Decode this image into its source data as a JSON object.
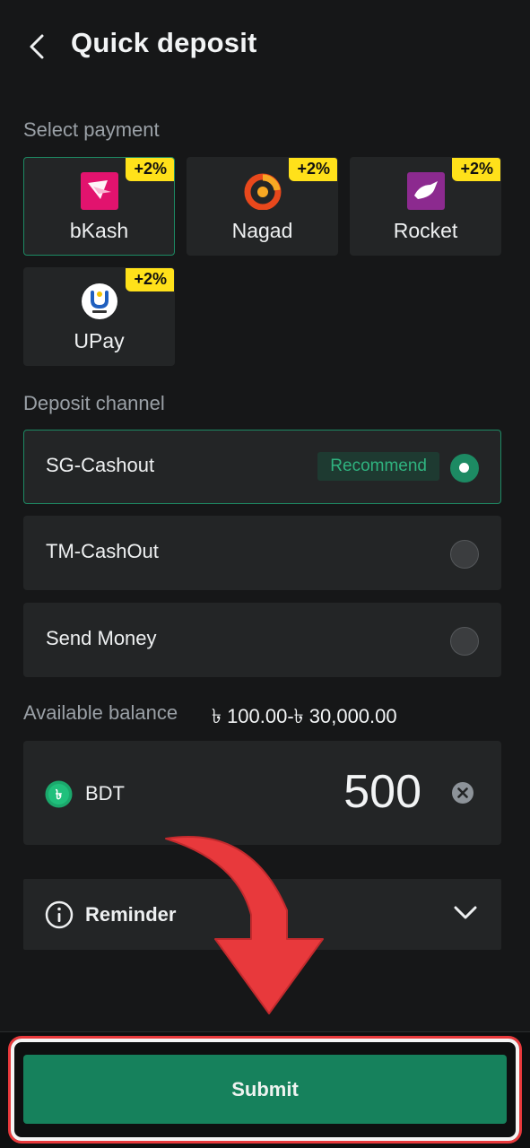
{
  "header": {
    "title": "Quick deposit"
  },
  "payment": {
    "label": "Select payment",
    "options": [
      {
        "name": "bKash",
        "badge": "+2%",
        "selected": true
      },
      {
        "name": "Nagad",
        "badge": "+2%",
        "selected": false
      },
      {
        "name": "Rocket",
        "badge": "+2%",
        "selected": false
      },
      {
        "name": "UPay",
        "badge": "+2%",
        "selected": false
      }
    ]
  },
  "channel": {
    "label": "Deposit channel",
    "options": [
      {
        "name": "SG-Cashout",
        "tag": "Recommend",
        "selected": true
      },
      {
        "name": "TM-CashOut",
        "selected": false
      },
      {
        "name": "Send Money",
        "selected": false
      }
    ]
  },
  "balance": {
    "label": "Available balance",
    "range": "৳ 100.00-৳ 30,000.00"
  },
  "amount": {
    "currency": "BDT",
    "value": "500"
  },
  "reminder": {
    "label": "Reminder"
  },
  "submit": {
    "label": "Submit"
  },
  "colors": {
    "accent": "#16815c",
    "badge": "#ffe11a",
    "annotation": "#e8393c"
  }
}
